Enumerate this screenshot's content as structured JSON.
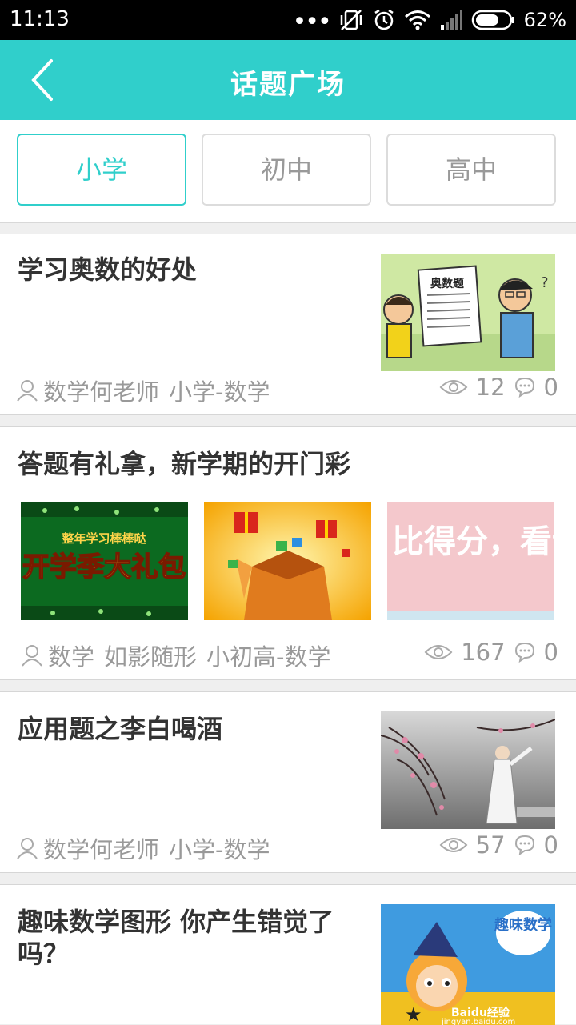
{
  "status_bar": {
    "time": "11:13",
    "battery": "62%"
  },
  "header": {
    "title": "话题广场"
  },
  "tabs": [
    {
      "label": "小学",
      "active": true
    },
    {
      "label": "初中",
      "active": false
    },
    {
      "label": "高中",
      "active": false
    }
  ],
  "posts": [
    {
      "title": "学习奥数的好处",
      "author": "数学何老师",
      "category": "小学-数学",
      "views": "12",
      "comments": "0",
      "thumb_text": "奥数题"
    },
    {
      "title": "答题有礼拿，新学期的开门彩",
      "author": "数学",
      "author2": "如影随形",
      "category": "小初高-数学",
      "views": "167",
      "comments": "0",
      "thumb1_subtitle": "整年学习棒棒哒",
      "thumb1_title": "开学季大礼包",
      "thumb3_text": "比得分，看谁更牛"
    },
    {
      "title": "应用题之李白喝酒",
      "author": "数学何老师",
      "category": "小学-数学",
      "views": "57",
      "comments": "0"
    },
    {
      "title": "趣味数学图形 你产生错觉了吗？",
      "thumb_text": "趣味数学",
      "watermark": "Baidu经验",
      "watermark_url": "jingyan.baidu.com"
    }
  ],
  "colors": {
    "accent": "#30cfcb",
    "muted": "#999999",
    "title": "#333333"
  }
}
